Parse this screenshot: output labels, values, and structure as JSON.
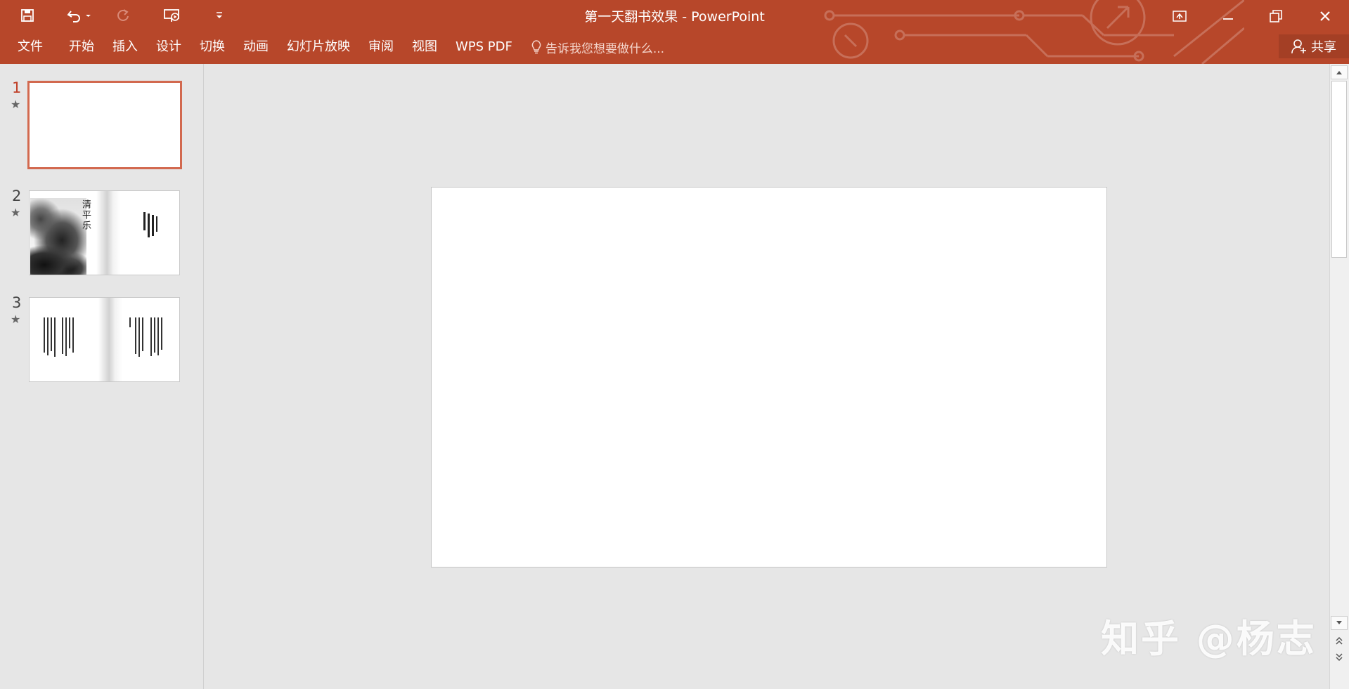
{
  "app": {
    "window_title": "第一天翻书效果 - PowerPoint",
    "accent_color": "#b7472a"
  },
  "quick_access": [
    {
      "icon": "save-icon"
    },
    {
      "icon": "undo-icon"
    },
    {
      "icon": "redo-icon"
    },
    {
      "icon": "present-from-start-icon"
    },
    {
      "icon": "customize-qat-icon"
    }
  ],
  "window_controls": [
    {
      "icon": "ribbon-display-options-icon"
    },
    {
      "icon": "minimize-icon"
    },
    {
      "icon": "restore-icon"
    },
    {
      "icon": "close-icon"
    }
  ],
  "ribbon": {
    "tabs": [
      "文件",
      "开始",
      "插入",
      "设计",
      "切换",
      "动画",
      "幻灯片放映",
      "审阅",
      "视图",
      "WPS PDF"
    ],
    "tell_me": "告诉我您想要做什么...",
    "share": "共享"
  },
  "slides": [
    {
      "number": "1",
      "selected": true,
      "has_animation": true,
      "content": "blank"
    },
    {
      "number": "2",
      "selected": false,
      "has_animation": true,
      "content": "ink-landscape-book",
      "title_text": "清平乐"
    },
    {
      "number": "3",
      "selected": false,
      "has_animation": true,
      "content": "vertical-text-book"
    }
  ],
  "watermark": "知乎 @杨志"
}
